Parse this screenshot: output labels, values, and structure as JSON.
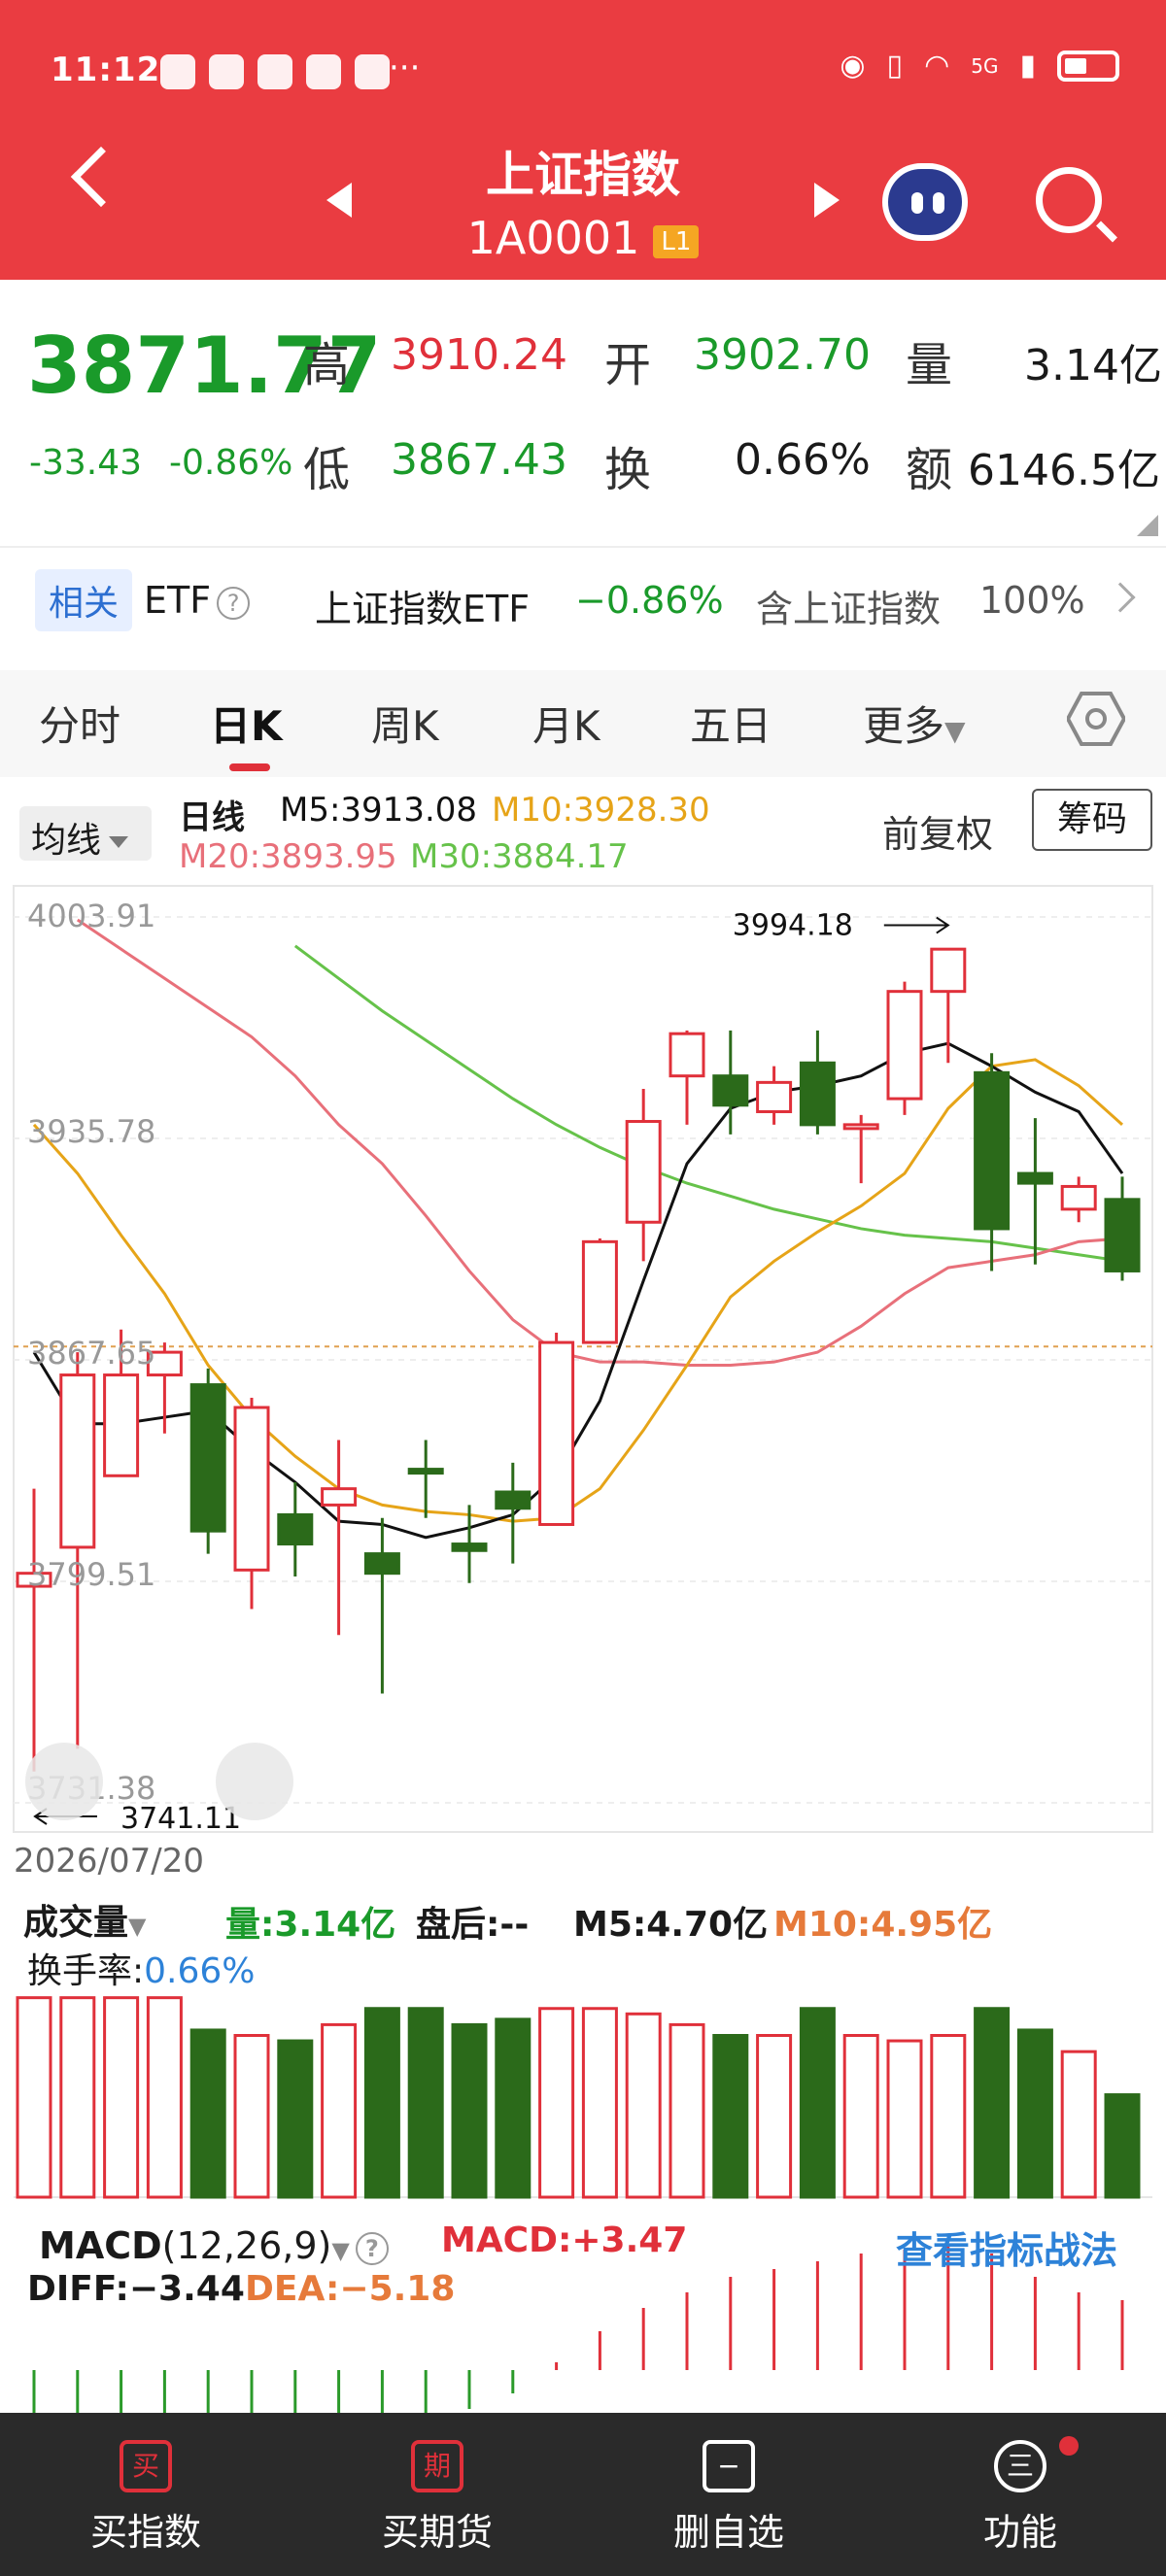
{
  "status_bar": {
    "time": "11:12",
    "more": "···",
    "net": "5G"
  },
  "header": {
    "title": "上证指数",
    "code": "1A0001",
    "level_badge": "L1"
  },
  "quote": {
    "price": "3871.77",
    "change": "-33.43",
    "change_pct": "-0.86%",
    "high_label": "高",
    "high": "3910.24",
    "open_label": "开",
    "open": "3902.70",
    "volume_label": "量",
    "volume": "3.14亿",
    "low_label": "低",
    "low": "3867.43",
    "turnover_label": "换",
    "turnover": "0.66%",
    "amount_label": "额",
    "amount": "6146.5亿"
  },
  "etf": {
    "badge": "相关",
    "label": "ETF",
    "name": "上证指数ETF",
    "change": "−0.86%",
    "contains": "含上证指数",
    "pct": "100%",
    "help": "?"
  },
  "tabs": [
    {
      "label": "分时"
    },
    {
      "label": "日K"
    },
    {
      "label": "周K"
    },
    {
      "label": "月K"
    },
    {
      "label": "五日"
    },
    {
      "label": "更多"
    }
  ],
  "ma_legend": {
    "button": "均线",
    "period": "日线",
    "m5": "M5:3913.08",
    "m10": "M10:3928.30",
    "m20": "M20:3893.95",
    "m30": "M30:3884.17",
    "fuquan": "前复权",
    "chouma": "筹码"
  },
  "colors": {
    "up": "#e0303a",
    "down": "#2b6a1a",
    "m5": "#111111",
    "m10": "#e6a418",
    "m20": "#e8707a",
    "m30": "#66c24a",
    "header": "#ea3c41"
  },
  "chart_data": {
    "type": "candlestick",
    "axis_labels": [
      "4003.91",
      "3935.78",
      "3867.65",
      "3799.51",
      "3731.38"
    ],
    "ylim": [
      3731.38,
      4003.91
    ],
    "max_annotation": "3994.18",
    "min_annotation": "3741.11",
    "date": "2026/07/20",
    "candles": [
      {
        "open": 3798,
        "close": 3802,
        "high": 3828,
        "low": 3741
      },
      {
        "open": 3810,
        "close": 3863,
        "high": 3870,
        "low": 3748
      },
      {
        "open": 3832,
        "close": 3863,
        "high": 3877,
        "low": 3832
      },
      {
        "open": 3863,
        "close": 3870,
        "high": 3873,
        "low": 3845
      },
      {
        "open": 3860,
        "close": 3815,
        "high": 3865,
        "low": 3808
      },
      {
        "open": 3803,
        "close": 3853,
        "high": 3856,
        "low": 3791
      },
      {
        "open": 3820,
        "close": 3811,
        "high": 3830,
        "low": 3801
      },
      {
        "open": 3823,
        "close": 3828,
        "high": 3843,
        "low": 3783
      },
      {
        "open": 3808,
        "close": 3802,
        "high": 3819,
        "low": 3765
      },
      {
        "open": 3834,
        "close": 3833,
        "high": 3843,
        "low": 3819
      },
      {
        "open": 3811,
        "close": 3809,
        "high": 3823,
        "low": 3799
      },
      {
        "open": 3827,
        "close": 3822,
        "high": 3836,
        "low": 3805
      },
      {
        "open": 3817,
        "close": 3873,
        "high": 3876,
        "low": 3817
      },
      {
        "open": 3873,
        "close": 3904,
        "high": 3905,
        "low": 3873
      },
      {
        "open": 3910,
        "close": 3941,
        "high": 3951,
        "low": 3898
      },
      {
        "open": 3955,
        "close": 3968,
        "high": 3969,
        "low": 3940
      },
      {
        "open": 3955,
        "close": 3946,
        "high": 3969,
        "low": 3937
      },
      {
        "open": 3944,
        "close": 3953,
        "high": 3958,
        "low": 3940
      },
      {
        "open": 3959,
        "close": 3940,
        "high": 3969,
        "low": 3937
      },
      {
        "open": 3939,
        "close": 3940,
        "high": 3943,
        "low": 3922
      },
      {
        "open": 3948,
        "close": 3981,
        "high": 3984,
        "low": 3943
      },
      {
        "open": 3981,
        "close": 3994,
        "high": 3994,
        "low": 3959
      },
      {
        "open": 3956,
        "close": 3908,
        "high": 3962,
        "low": 3895
      },
      {
        "open": 3925,
        "close": 3922,
        "high": 3942,
        "low": 3897
      },
      {
        "open": 3914,
        "close": 3921,
        "high": 3924,
        "low": 3910
      },
      {
        "open": 3917,
        "close": 3895,
        "high": 3924,
        "low": 3892
      }
    ],
    "ma5": [
      3870,
      3848,
      3848,
      3850,
      3852,
      3840,
      3830,
      3818,
      3817,
      3813,
      3816,
      3820,
      3832,
      3855,
      3892,
      3928,
      3945,
      3950,
      3952,
      3955,
      3962,
      3965,
      3958,
      3950,
      3944,
      3925
    ],
    "ma10": [
      3940,
      3925,
      3906,
      3888,
      3866,
      3850,
      3838,
      3828,
      3823,
      3821,
      3820,
      3818,
      3819,
      3828,
      3846,
      3866,
      3887,
      3898,
      3907,
      3915,
      3925,
      3945,
      3958,
      3960,
      3952,
      3940
    ],
    "ma20": [
      null,
      4003,
      3994,
      3985,
      3976,
      3967,
      3955,
      3940,
      3928,
      3912,
      3895,
      3880,
      3870,
      3867,
      3867,
      3866,
      3866,
      3867,
      3870,
      3878,
      3888,
      3896,
      3898,
      3900,
      3904,
      3905
    ],
    "ma30": [
      null,
      null,
      null,
      null,
      null,
      null,
      3995,
      3985,
      3975,
      3966,
      3957,
      3948,
      3940,
      3933,
      3927,
      3922,
      3918,
      3914,
      3911,
      3908,
      3906,
      3905,
      3904,
      3902,
      3900,
      3898
    ],
    "volume": [
      3.7,
      3.7,
      3.7,
      3.7,
      3.1,
      3.0,
      2.9,
      3.2,
      3.5,
      3.5,
      3.2,
      3.3,
      3.5,
      3.5,
      3.4,
      3.2,
      3.0,
      3.0,
      3.5,
      3.0,
      2.9,
      3.0,
      3.5,
      3.1,
      2.7,
      1.9
    ],
    "macd": [
      -3.0,
      -2.8,
      -2.6,
      -2.5,
      -2.4,
      -2.3,
      -2.1,
      -1.9,
      -1.6,
      -1.3,
      -1.0,
      -0.6,
      0.2,
      1.0,
      1.6,
      2.0,
      2.4,
      2.6,
      2.8,
      3.0,
      3.1,
      3.2,
      3.0,
      2.4,
      2.0,
      1.8
    ]
  },
  "volume_legend": {
    "button": "成交量",
    "vol": "量:3.14亿",
    "after_hours": "盘后:--",
    "m5": "M5:4.70亿",
    "m10": "M10:4.95亿",
    "turnover": "换手率:",
    "turnover_val": "0.66%"
  },
  "macd_legend": {
    "name": "MACD",
    "params": "(12,26,9)",
    "macd": "MACD:+3.47",
    "diff": "DIFF:−3.44",
    "dea": "DEA:−5.18",
    "link": "查看指标战法",
    "help": "?"
  },
  "bottom_nav": [
    {
      "icon": "买",
      "label": "买指数"
    },
    {
      "icon": "期",
      "label": "买期货"
    },
    {
      "icon": "−",
      "label": "删自选"
    },
    {
      "icon": "三",
      "label": "功能"
    }
  ]
}
